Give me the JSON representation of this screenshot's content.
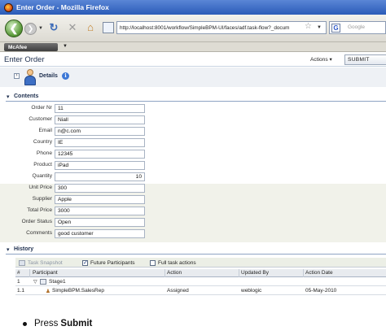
{
  "window": {
    "title": "Enter Order - Mozilla Firefox"
  },
  "browser": {
    "url": "http://localhost:8001/workflow/SimpleBPM-UI/faces/adf.task-flow?_docum",
    "search_placeholder": "Google",
    "mcafee_label": "McAfee"
  },
  "header": {
    "title": "Enter Order",
    "actions_label": "Actions",
    "submit_label": "SUBMIT"
  },
  "details": {
    "label": "Details"
  },
  "contents": {
    "label": "Contents",
    "fields": [
      {
        "label": "Order Nr",
        "value": "11"
      },
      {
        "label": "Customer",
        "value": "Niall"
      },
      {
        "label": "Email",
        "value": "n@c.com"
      },
      {
        "label": "Country",
        "value": "IE"
      },
      {
        "label": "Phone",
        "value": "12345"
      },
      {
        "label": "Product",
        "value": "iPad"
      },
      {
        "label": "Quantity",
        "value": "10"
      },
      {
        "label": "Unit Price",
        "value": "300"
      },
      {
        "label": "Supplier",
        "value": "Apple"
      },
      {
        "label": "Total Price",
        "value": "3000"
      },
      {
        "label": "Order Status",
        "value": "Open"
      },
      {
        "label": "Comments",
        "value": "good customer"
      }
    ]
  },
  "history": {
    "label": "History",
    "toolbar": {
      "task_snapshot": "Task Snapshot",
      "future_participants": "Future Participants",
      "full_task_actions": "Full task actions"
    },
    "columns": [
      "#",
      "Participant",
      "Action",
      "Updated By",
      "Action Date"
    ],
    "rows": [
      {
        "num": "1",
        "participant": "Stage1",
        "action": "",
        "updated_by": "",
        "date": ""
      },
      {
        "num": "1.1",
        "participant": "SimpleBPM.SalesRep",
        "action": "Assigned",
        "updated_by": "weblogic",
        "date": "05-May-2010"
      }
    ]
  },
  "instruction": {
    "prefix": "Press",
    "emphasis": "Submit"
  }
}
